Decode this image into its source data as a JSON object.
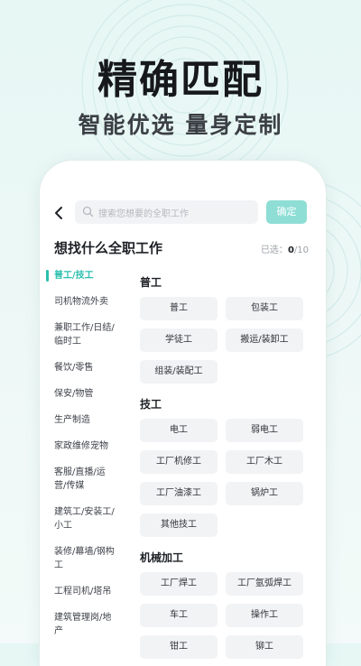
{
  "promo": {
    "headline": "精确匹配",
    "subline": "智能优选 量身定制"
  },
  "screen": {
    "search_placeholder": "搜索您想要的全职工作",
    "confirm_label": "确定",
    "page_title": "想找什么全职工作",
    "selected_label": "已选：",
    "selected_count": "0",
    "selected_max": "/10",
    "sidebar": [
      {
        "label": "普工/技工",
        "active": true
      },
      {
        "label": "司机物流外卖"
      },
      {
        "label": "兼职工作/日结/临时工"
      },
      {
        "label": "餐饮/零售"
      },
      {
        "label": "保安/物管"
      },
      {
        "label": "生产制造"
      },
      {
        "label": "家政维修宠物"
      },
      {
        "label": "客服/直播/运营/传媒"
      },
      {
        "label": "建筑工/安装工/小工"
      },
      {
        "label": "装修/幕墙/钢构工"
      },
      {
        "label": "工程司机/塔吊"
      },
      {
        "label": "建筑管理岗/地产"
      }
    ],
    "sections": [
      {
        "title": "普工",
        "items": [
          "普工",
          "包装工",
          "学徒工",
          "搬运/装卸工",
          "组装/装配工"
        ]
      },
      {
        "title": "技工",
        "items": [
          "电工",
          "弱电工",
          "工厂机修工",
          "工厂木工",
          "工厂油漆工",
          "锅炉工",
          "其他技工"
        ]
      },
      {
        "title": "机械加工",
        "items": [
          "工厂焊工",
          "工厂氩弧焊工",
          "车工",
          "操作工",
          "钳工",
          "铆工"
        ]
      }
    ]
  },
  "colors": {
    "accent": "#2bbfae",
    "confirm_bg": "#8fded5",
    "chip_bg": "#f2f3f5"
  }
}
